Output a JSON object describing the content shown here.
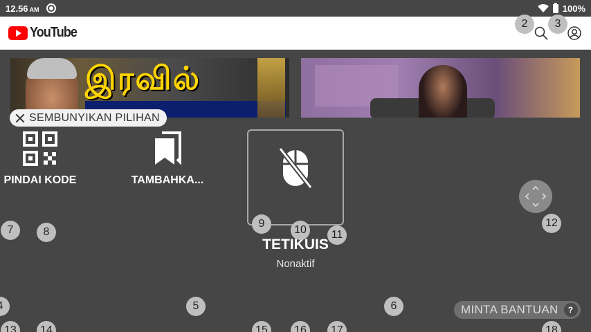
{
  "status_bar": {
    "time": "12.56",
    "ampm": "AM",
    "battery": "100%"
  },
  "header": {
    "logo_text": "YouTube"
  },
  "thumbnails": [
    {
      "title_text": "இரவில்"
    },
    {}
  ],
  "overlay": {
    "hide_label": "SEMBUNYIKAN PILIHAN",
    "scan_label": "PINDAI KODE",
    "bookmark_label": "TAMBAHKA...",
    "mouse_label": "TETIKUIS",
    "mouse_status": "Nonaktif",
    "help_label": "MINTA BANTUAN",
    "help_icon": "?"
  },
  "markers": [
    "2",
    "3",
    "4",
    "5",
    "6",
    "7",
    "8",
    "9",
    "10",
    "11",
    "12",
    "13",
    "14",
    "15",
    "16",
    "17",
    "18"
  ],
  "colors": {
    "youtube_red": "#ff0000",
    "overlay_bg": "#464646",
    "marker_bg": "#bfbfbf"
  }
}
